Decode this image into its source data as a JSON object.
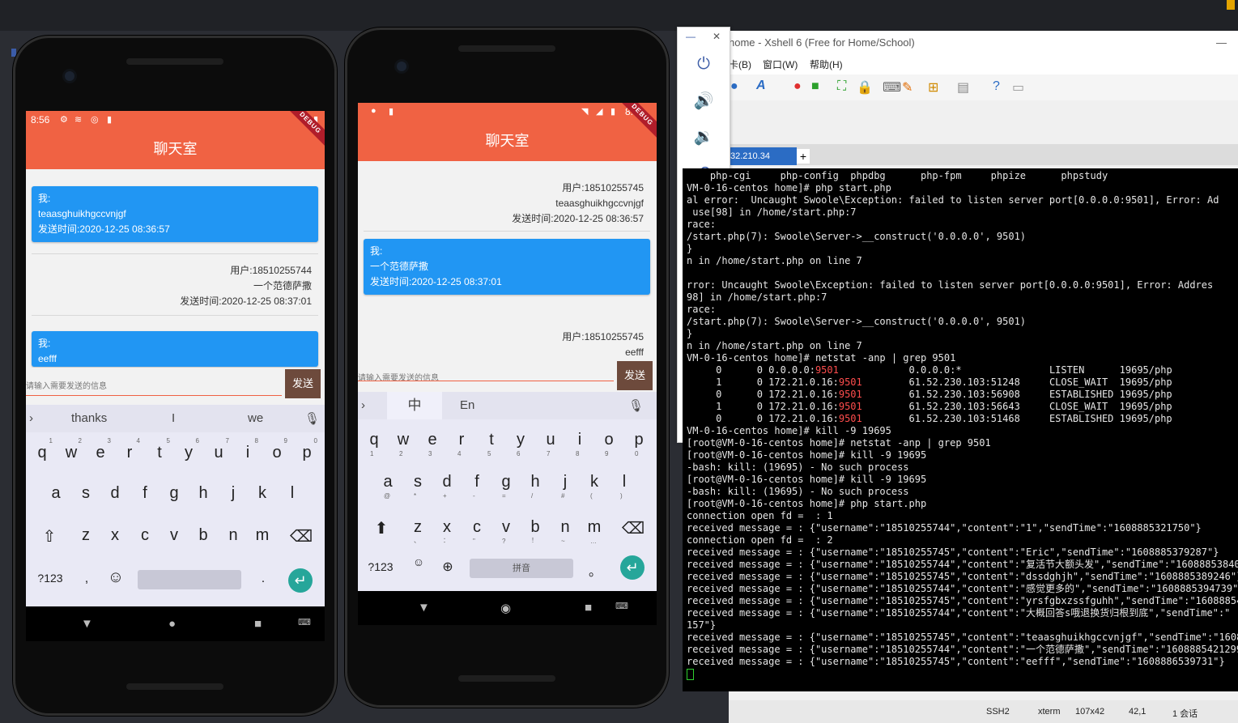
{
  "xshell": {
    "title": "home - Xshell 6 (Free for Home/School)",
    "menu": [
      "卡(B)",
      "窗口(W)",
      "帮助(H)"
    ],
    "tab_label": "32.210.34",
    "tab_plus": "+",
    "status": {
      "protocol": "SSH2",
      "term": "xterm",
      "size": "107x42",
      "pos": "42,1",
      "sessions": "1 会话"
    },
    "terminal": [
      {
        "text": "    php-cgi     php-config  phpdbg      php-fpm     phpize      phpstudy"
      },
      {
        "text": "VM-0-16-centos home]# php start.php"
      },
      {
        "text": "al error:  Uncaught Swoole\\Exception: failed to listen server port[0.0.0.0:9501], Error: Ad"
      },
      {
        "text": " use[98] in /home/start.php:7"
      },
      {
        "text": "race:"
      },
      {
        "text": "/start.php(7): Swoole\\Server->__construct('0.0.0.0', 9501)"
      },
      {
        "text": "}"
      },
      {
        "text": "n in /home/start.php on line 7"
      },
      {
        "text": ""
      },
      {
        "text": "rror: Uncaught Swoole\\Exception: failed to listen server port[0.0.0.0:9501], Error: Addres"
      },
      {
        "text": "98] in /home/start.php:7"
      },
      {
        "text": "race:"
      },
      {
        "text": "/start.php(7): Swoole\\Server->__construct('0.0.0.0', 9501)"
      },
      {
        "text": "}"
      },
      {
        "text": "n in /home/start.php on line 7"
      },
      {
        "text": "VM-0-16-centos home]# netstat -anp | grep 9501"
      },
      {
        "pre": "     0      0 0.0.0.0:",
        "hl": "9501",
        "post": "            0.0.0.0:*               LISTEN      19695/php"
      },
      {
        "pre": "     1      0 172.21.0.16:",
        "hl": "9501",
        "post": "        61.52.230.103:51248     CLOSE_WAIT  19695/php"
      },
      {
        "pre": "     0      0 172.21.0.16:",
        "hl": "9501",
        "post": "        61.52.230.103:56908     ESTABLISHED 19695/php"
      },
      {
        "pre": "     1      0 172.21.0.16:",
        "hl": "9501",
        "post": "        61.52.230.103:56643     CLOSE_WAIT  19695/php"
      },
      {
        "pre": "     0      0 172.21.0.16:",
        "hl": "9501",
        "post": "        61.52.230.103:51468     ESTABLISHED 19695/php"
      },
      {
        "text": "VM-0-16-centos home]# kill -9 19695"
      },
      {
        "text": "[root@VM-0-16-centos home]# netstat -anp | grep 9501"
      },
      {
        "text": "[root@VM-0-16-centos home]# kill -9 19695"
      },
      {
        "text": "-bash: kill: (19695) - No such process"
      },
      {
        "text": "[root@VM-0-16-centos home]# kill -9 19695"
      },
      {
        "text": "-bash: kill: (19695) - No such process"
      },
      {
        "text": "[root@VM-0-16-centos home]# php start.php"
      },
      {
        "text": "connection open fd =  : 1"
      },
      {
        "text": "received message = : {\"username\":\"18510255744\",\"content\":\"1\",\"sendTime\":\"1608885321750\"}"
      },
      {
        "text": "connection open fd =  : 2"
      },
      {
        "text": "received message = : {\"username\":\"18510255745\",\"content\":\"Eric\",\"sendTime\":\"1608885379287\"}"
      },
      {
        "text": "received message = : {\"username\":\"18510255744\",\"content\":\"复活节大额头发\",\"sendTime\":\"16088853840"
      },
      {
        "text": "received message = : {\"username\":\"18510255745\",\"content\":\"dssdghjh\",\"sendTime\":\"1608885389246\"}"
      },
      {
        "text": "received message = : {\"username\":\"18510255744\",\"content\":\"感觉更多的\",\"sendTime\":\"1608885394739\"}"
      },
      {
        "text": "received message = : {\"username\":\"18510255745\",\"content\":\"yrsfgbxzssfguhh\",\"sendTime\":\"160888540"
      },
      {
        "text": "received message = : {\"username\":\"18510255744\",\"content\":\"大概回答s哦退换货归根到底\",\"sendTime\":\""
      },
      {
        "text": "157\"}"
      },
      {
        "text": "received message = : {\"username\":\"18510255745\",\"content\":\"teaasghuikhgccvnjgf\",\"sendTime\":\"160888"
      },
      {
        "text": "received message = : {\"username\":\"18510255744\",\"content\":\"一个范德萨撒\",\"sendTime\":\"1608885421299"
      },
      {
        "text": "received message = : {\"username\":\"18510255745\",\"content\":\"eefff\",\"sendTime\":\"1608886539731\"}"
      }
    ]
  },
  "phone1": {
    "time": "8:56",
    "title": "聊天室",
    "debug": "DEBUG",
    "messages": [
      {
        "who": "我:",
        "content": "teaasghuikhgccvnjgf",
        "time": "发送时间:2020-12-25 08:36:57"
      },
      {
        "user": "用户:18510255744",
        "content": "一个范德萨撒",
        "time": "发送时间:2020-12-25 08:37:01"
      },
      {
        "who": "我:",
        "content": "eefff"
      }
    ],
    "placeholder": "请输入需要发送的信息",
    "send": "发送",
    "suggestions": [
      "thanks",
      "I",
      "we"
    ],
    "row1": [
      "q",
      "w",
      "e",
      "r",
      "t",
      "y",
      "u",
      "i",
      "o",
      "p"
    ],
    "row1_nums": [
      "1",
      "2",
      "3",
      "4",
      "5",
      "6",
      "7",
      "8",
      "9",
      "0"
    ],
    "row2": [
      "a",
      "s",
      "d",
      "f",
      "g",
      "h",
      "j",
      "k",
      "l"
    ],
    "row3": [
      "z",
      "x",
      "c",
      "v",
      "b",
      "n",
      "m"
    ],
    "sym": "?123",
    "comma": ",",
    "period": "."
  },
  "phone2": {
    "time": "8:56",
    "title": "聊天室",
    "debug": "DEBUG",
    "messages": [
      {
        "user": "用户:18510255745",
        "content": "teaasghuikhgccvnjgf",
        "time": "发送时间:2020-12-25 08:36:57"
      },
      {
        "who": "我:",
        "content": "一个范德萨撒",
        "time": "发送时间:2020-12-25 08:37:01"
      },
      {
        "user": "用户:18510255745",
        "content": "eefff"
      }
    ],
    "placeholder": "请输入需要发送的信息",
    "send": "发送",
    "lang_zh": "中",
    "lang_en": "En",
    "row1": [
      "q",
      "w",
      "e",
      "r",
      "t",
      "y",
      "u",
      "i",
      "o",
      "p"
    ],
    "row1_nums": [
      "1",
      "2",
      "3",
      "4",
      "5",
      "6",
      "7",
      "8",
      "9",
      "0"
    ],
    "row2": [
      "a",
      "s",
      "d",
      "f",
      "g",
      "h",
      "j",
      "k",
      "l"
    ],
    "row2_sub": [
      "@",
      "*",
      "+",
      "-",
      "=",
      "/",
      "#",
      "(",
      ")"
    ],
    "row3": [
      "z",
      "x",
      "c",
      "v",
      "b",
      "n",
      "m"
    ],
    "row3_sub": [
      "、",
      "：",
      "\"",
      "?",
      "！",
      "~",
      "…"
    ],
    "sym": "?123",
    "space": "拼音",
    "period": "。"
  }
}
